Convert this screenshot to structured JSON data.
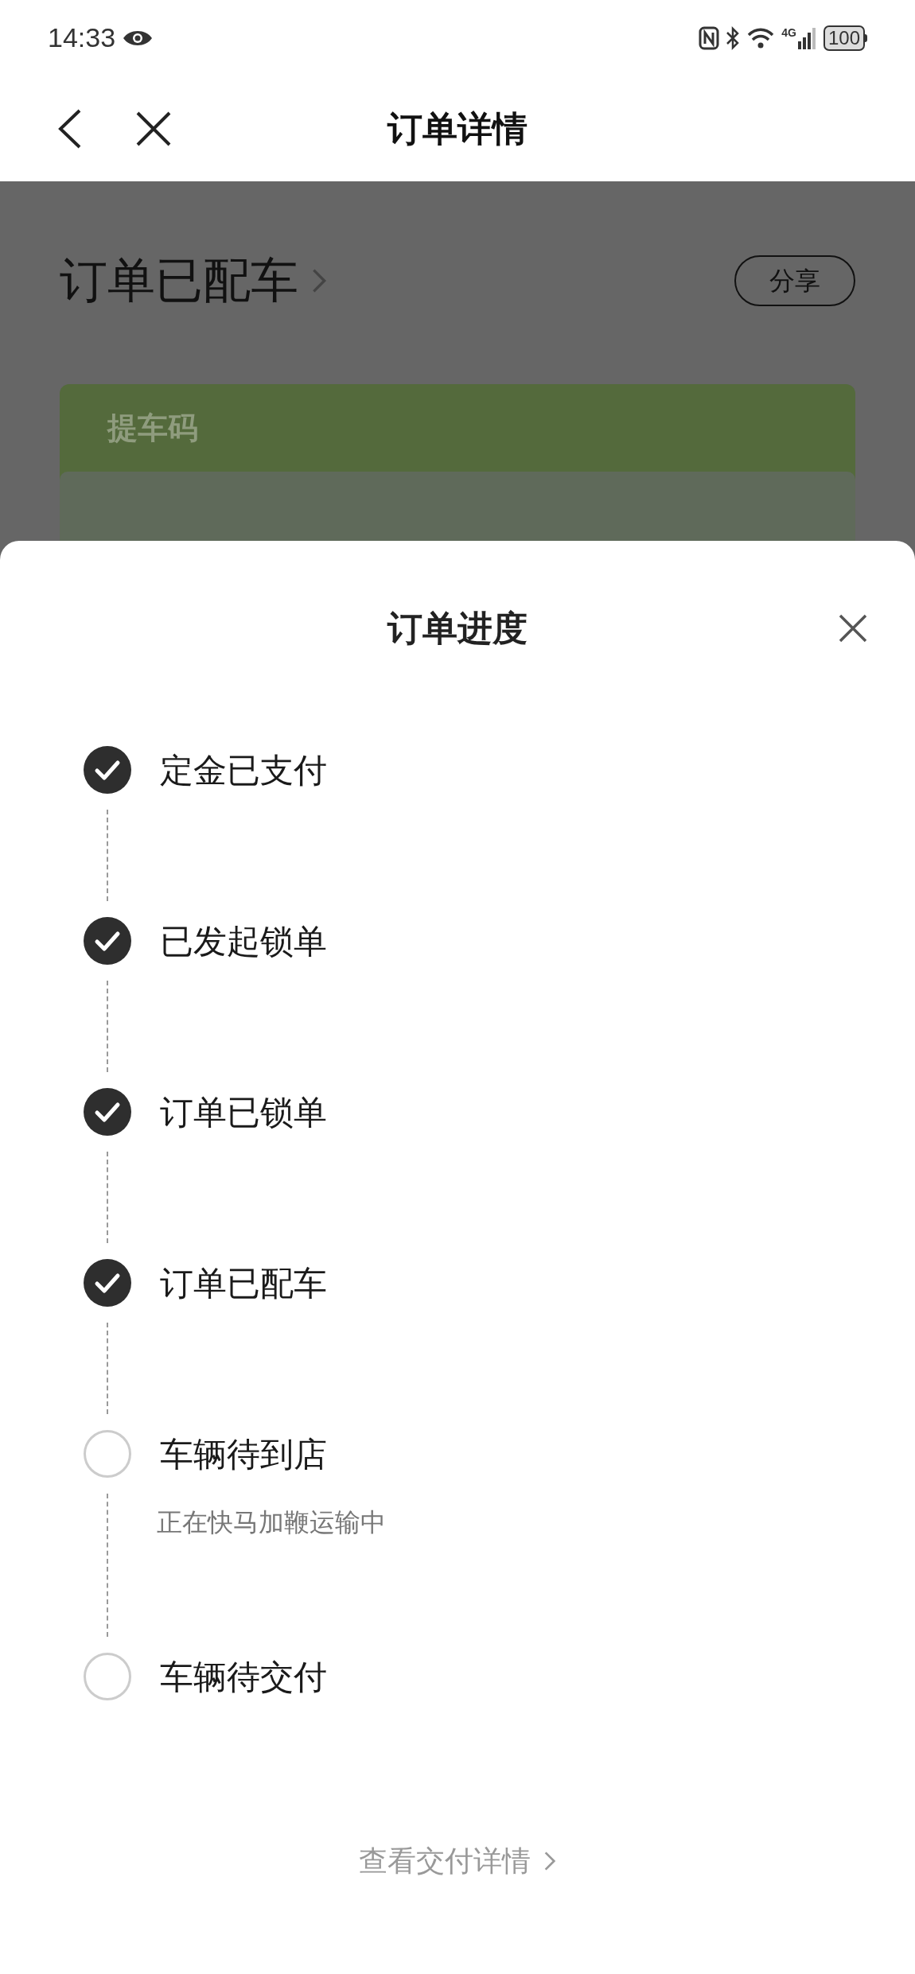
{
  "status_bar": {
    "time": "14:33",
    "network": "4G",
    "battery": "100"
  },
  "nav": {
    "title": "订单详情"
  },
  "background": {
    "status": "订单已配车",
    "share_button": "分享",
    "card": {
      "label": "提车码"
    }
  },
  "sheet": {
    "title": "订单进度",
    "steps": [
      {
        "label": "定金已支付",
        "done": true
      },
      {
        "label": "已发起锁单",
        "done": true
      },
      {
        "label": "订单已锁单",
        "done": true
      },
      {
        "label": "订单已配车",
        "done": true
      },
      {
        "label": "车辆待到店",
        "done": false,
        "note": "正在快马加鞭运输中"
      },
      {
        "label": "车辆待交付",
        "done": false
      }
    ],
    "link": "查看交付详情"
  }
}
